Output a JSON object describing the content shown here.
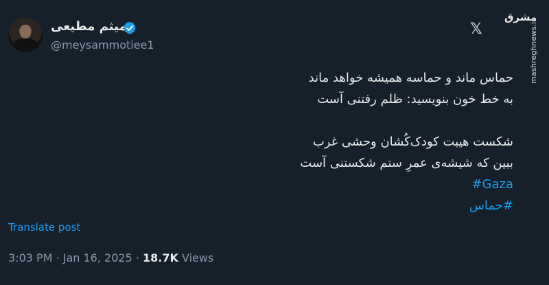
{
  "author": {
    "display_name": "میثم مطیعی",
    "handle": "@meysammotiee1",
    "verified": true
  },
  "header": {
    "x_logo_text": "𝕏",
    "watermark_logo": "مشرق",
    "watermark_url": "mashreghnews.ir"
  },
  "post": {
    "lines": [
      "حماس ماند و حماسه همیشه خواهد ماند",
      "به خط خون بنویسید: ظلم رفتنی آست",
      "",
      "شکست هیبت کودک‌کُشان وحشی غرب",
      "ببین که شیشه‌ی عمرِ ستم شکستنی آست"
    ],
    "hashtags": [
      "#Gaza",
      "#حماس"
    ]
  },
  "translate_label": "Translate post",
  "meta": {
    "time": "3:03 PM",
    "separator": "·",
    "date": "Jan 16, 2025",
    "views_count": "18.7K",
    "views_label": "Views"
  },
  "colors": {
    "background": "#15202b",
    "link": "#1d9bf0",
    "secondary_text": "#8b98a5",
    "primary_text": "#e7e9ea"
  }
}
